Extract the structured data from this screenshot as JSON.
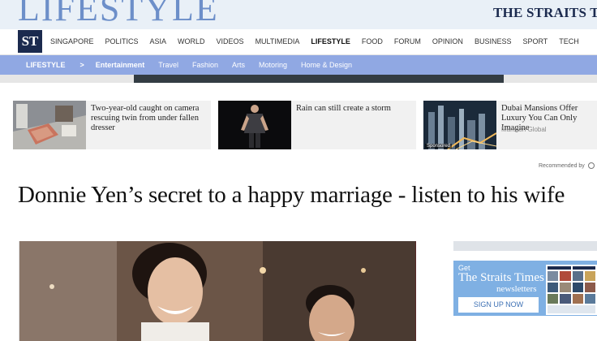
{
  "header": {
    "section_title": "LIFESTYLE",
    "masthead": "THE STRAITS TIMES",
    "logo": "ST"
  },
  "main_nav": [
    "SINGAPORE",
    "POLITICS",
    "ASIA",
    "WORLD",
    "VIDEOS",
    "MULTIMEDIA",
    "LIFESTYLE",
    "FOOD",
    "FORUM",
    "OPINION",
    "BUSINESS",
    "SPORT",
    "TECH"
  ],
  "main_nav_active": "LIFESTYLE",
  "sub_nav": {
    "section": "LIFESTYLE",
    "chevron": ">",
    "current": "Entertainment",
    "items": [
      "Travel",
      "Fashion",
      "Arts",
      "Motoring",
      "Home & Design"
    ]
  },
  "recommended": [
    {
      "title": "Two-year-old caught on camera rescuing twin from under fallen dresser",
      "source": ""
    },
    {
      "title": "Rain can still create a storm",
      "source": ""
    },
    {
      "title": "Dubai Mansions Offer Luxury You Can Only Imagine",
      "source": "Mansion Global",
      "badge": "Sponsored"
    }
  ],
  "recommended_by": "Recommended by",
  "article": {
    "headline": "Donnie Yen’s secret to a happy marriage - listen to his wife"
  },
  "newsletter": {
    "get": "Get",
    "title": "The Straits Times",
    "subtitle": "newsletters",
    "button": "SIGN UP NOW"
  },
  "colors": {
    "accent": "#90a8e3",
    "brand_navy": "#1b2a4e",
    "newsletter_blue": "#7fb0e3"
  }
}
